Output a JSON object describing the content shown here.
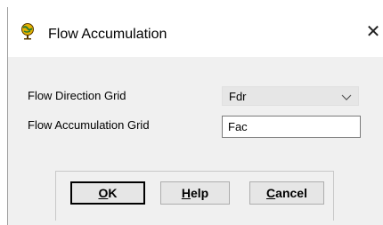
{
  "window": {
    "title": "Flow Accumulation",
    "icon": "globe-pin-icon",
    "close_glyph": "✕"
  },
  "form": {
    "flow_direction_label": "Flow Direction Grid",
    "flow_direction_value": "Fdr",
    "flow_accumulation_label": "Flow Accumulation Grid",
    "flow_accumulation_value": "Fac"
  },
  "buttons": {
    "ok": {
      "mnemonic": "O",
      "rest": "K"
    },
    "help": {
      "mnemonic": "H",
      "rest": "elp"
    },
    "cancel": {
      "mnemonic": "C",
      "rest": "ancel"
    }
  }
}
